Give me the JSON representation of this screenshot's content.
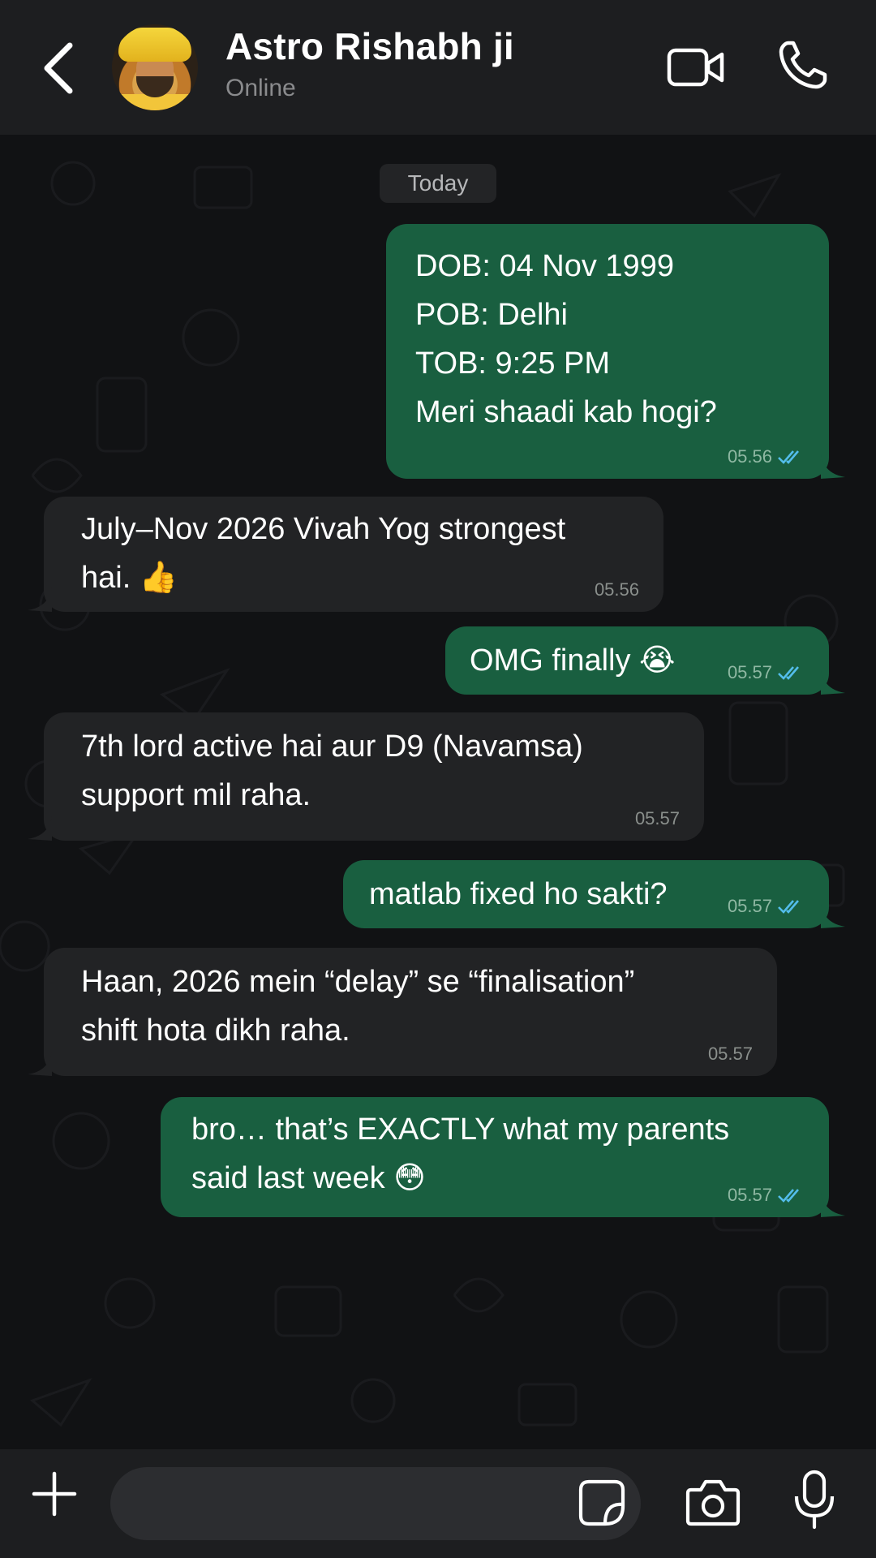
{
  "header": {
    "contact_name": "Astro Rishabh ji",
    "status": "Online"
  },
  "chat": {
    "date_label": "Today",
    "messages": [
      {
        "direction": "out",
        "text": "DOB: 04 Nov 1999\nPOB: Delhi\nTOB: 9:25 PM\nMeri shaadi kab hogi?",
        "time": "05.56",
        "read": true
      },
      {
        "direction": "in",
        "text": "July–Nov 2026 Vivah Yog strongest\nhai. 👍",
        "time": "05.56"
      },
      {
        "direction": "out",
        "text": "OMG finally 😭",
        "time": "05.57",
        "read": true
      },
      {
        "direction": "in",
        "text": "7th lord active hai aur D9 (Navamsa)\nsupport mil raha.",
        "time": "05.57"
      },
      {
        "direction": "out",
        "text": "matlab fixed ho sakti?",
        "time": "05.57",
        "read": true
      },
      {
        "direction": "in",
        "text": "Haan, 2026 mein “delay” se “finalisation”\nshift hota dikh raha.",
        "time": "05.57"
      },
      {
        "direction": "out",
        "text": "bro… that’s EXACTLY what my parents\nsaid last week 😳",
        "time": "05.57",
        "read": true
      }
    ]
  },
  "composer": {
    "input_value": "",
    "input_placeholder": ""
  },
  "icons": {
    "back": "chevron-left-icon",
    "video": "video-camera-icon",
    "phone": "phone-icon",
    "plus": "plus-icon",
    "sticker": "sticker-icon",
    "camera": "camera-icon",
    "mic": "microphone-icon"
  },
  "colors": {
    "header_bg": "#1d1e20",
    "chat_bg": "#111214",
    "outgoing_bubble": "#195f40",
    "incoming_bubble": "#222325",
    "read_ticks": "#53bdeb"
  }
}
